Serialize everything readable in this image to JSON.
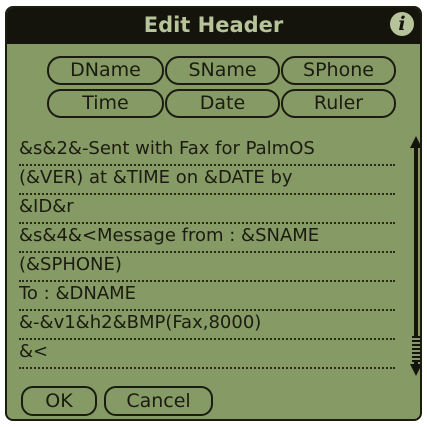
{
  "dialog": {
    "title": "Edit Header",
    "info_icon": "i"
  },
  "tokens": {
    "row1": [
      "DName",
      "SName",
      "SPhone"
    ],
    "row2": [
      "Time",
      "Date",
      "Ruler"
    ]
  },
  "editor": {
    "lines": [
      "&s&2&-Sent with Fax for PalmOS",
      "(&VER) at &TIME on &DATE by",
      "&ID&r",
      "&s&4&<Message from : &SNAME",
      "(&SPHONE)",
      "To : &DNAME",
      "&-&v1&h2&BMP(Fax,8000)",
      "&<"
    ]
  },
  "buttons": {
    "ok": "OK",
    "cancel": "Cancel"
  },
  "colors": {
    "screen": "#869a65",
    "ink": "#1b1b10",
    "title_text": "#b7c49a"
  }
}
